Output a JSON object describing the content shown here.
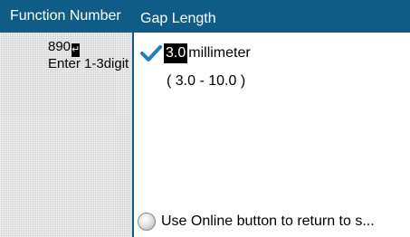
{
  "background": {
    "header_title": "Function Number",
    "current_value": "890",
    "enter_key_symbol": "↵",
    "hint": "Enter 1-3digit"
  },
  "popup": {
    "title": "Gap Length",
    "selected_value": "3.0",
    "unit": "millimeter",
    "range": "( 3.0 - 10.0 )",
    "check_icon": "checkmark-icon",
    "footer_icon": "online-button-icon",
    "footer_text": "Use Online button to return to s..."
  },
  "colors": {
    "header_blue": "#0f5d86",
    "check_blue": "#1d7fc0"
  }
}
